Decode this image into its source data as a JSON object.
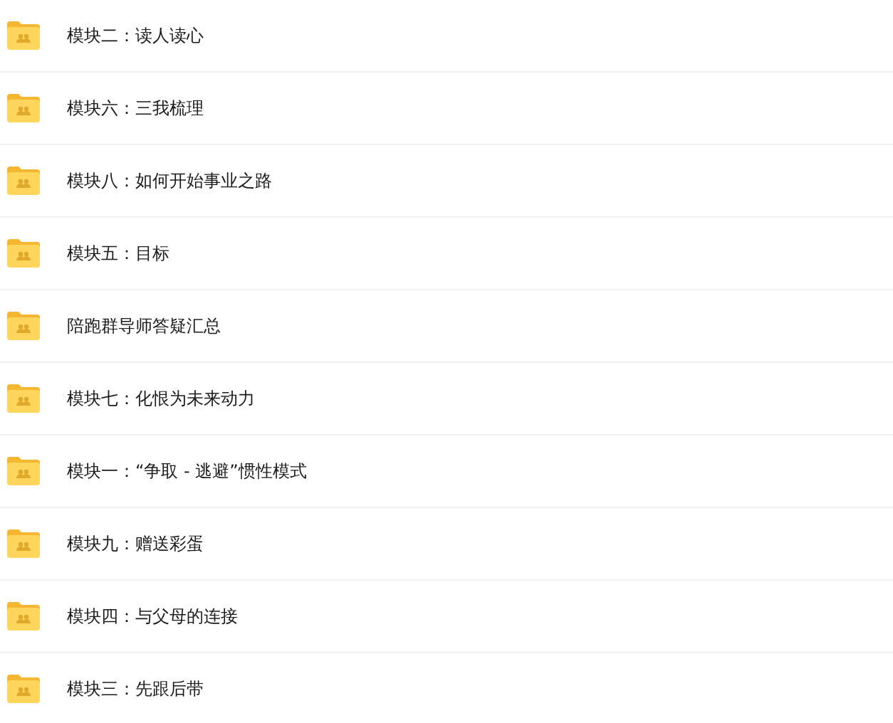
{
  "items": [
    {
      "name": "模块二：读人读心"
    },
    {
      "name": "模块六：三我梳理"
    },
    {
      "name": "模块八：如何开始事业之路"
    },
    {
      "name": "模块五：目标"
    },
    {
      "name": "陪跑群导师答疑汇总"
    },
    {
      "name": "模块七：化恨为未来动力"
    },
    {
      "name": "模块一：“争取 - 逃避”惯性模式"
    },
    {
      "name": "模块九：赠送彩蛋"
    },
    {
      "name": "模块四：与父母的连接"
    },
    {
      "name": "模块三：先跟后带"
    }
  ]
}
